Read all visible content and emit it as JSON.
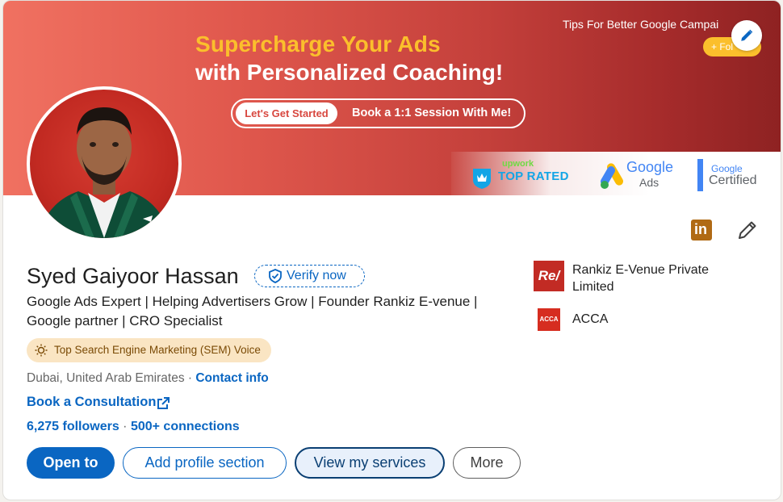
{
  "banner": {
    "headline_line1": "Supercharge Your Ads",
    "headline_line2": "with Personalized Coaching!",
    "cta_button": "Let's Get Started",
    "cta_text": "Book a 1:1 Session  With Me!",
    "tips_text": "Tips For Better Google Campai",
    "follow_label": "+ Fol",
    "badges": {
      "upwork_word": "upwork",
      "upwork_rated": "TOP RATED",
      "google_ads_word": "Google",
      "google_ads_sub": "Ads",
      "google_cert_word": "Google",
      "google_cert_sub": "Certified"
    }
  },
  "profile": {
    "name": "Syed Gaiyoor Hassan",
    "verify_label": "Verify now",
    "headline": "Google Ads Expert | Helping Advertisers Grow | Founder Rankiz E-venue | Google partner | CRO Specialist",
    "sem_badge": "Top Search Engine Marketing (SEM) Voice",
    "location": "Dubai, United Arab Emirates",
    "location_separator": " · ",
    "contact_info": "Contact info",
    "consultation_link": "Book a Consultation",
    "followers": "6,275 followers",
    "network_separator": " · ",
    "connections": "500+ connections"
  },
  "buttons": {
    "open_to": "Open to",
    "add_profile_section": "Add profile section",
    "view_services": "View my services",
    "more": "More"
  },
  "companies": [
    {
      "logo_text": "Re/",
      "name": "Rankiz E-Venue Private Limited"
    },
    {
      "logo_text": "ACCA",
      "name": "ACCA"
    }
  ],
  "icons": {
    "linkedin": "linkedin-icon",
    "edit": "pencil-icon"
  },
  "colors": {
    "brand_blue": "#0a66c2",
    "banner_start": "#f07161",
    "banner_end": "#8e2222",
    "banner_accent": "#fbbf2c",
    "badge_bg": "#fae5c3"
  }
}
